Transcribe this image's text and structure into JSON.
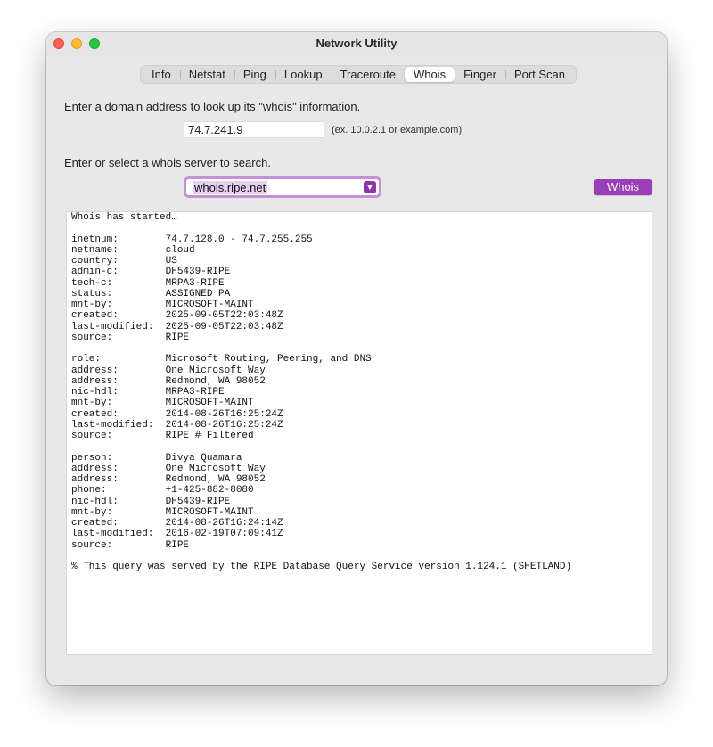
{
  "window": {
    "title": "Network Utility"
  },
  "tabs": [
    {
      "label": "Info",
      "selected": false
    },
    {
      "label": "Netstat",
      "selected": false
    },
    {
      "label": "Ping",
      "selected": false
    },
    {
      "label": "Lookup",
      "selected": false
    },
    {
      "label": "Traceroute",
      "selected": false
    },
    {
      "label": "Whois",
      "selected": true
    },
    {
      "label": "Finger",
      "selected": false
    },
    {
      "label": "Port Scan",
      "selected": false
    }
  ],
  "form": {
    "address_prompt": "Enter a domain address to look up its \"whois\" information.",
    "address_value": "74.7.241.9",
    "address_hint": "(ex. 10.0.2.1 or example.com)",
    "server_prompt": "Enter or select a whois server to search.",
    "server_value": "whois.ripe.net",
    "whois_button": "Whois"
  },
  "colors": {
    "accent": "#9b3fb8",
    "focus_ring": "#c193d6",
    "selection": "#e6cff0"
  },
  "output": {
    "lines": [
      "Whois has started…",
      "",
      "inetnum:        74.7.128.0 - 74.7.255.255",
      "netname:        cloud",
      "country:        US",
      "admin-c:        DH5439-RIPE",
      "tech-c:         MRPA3-RIPE",
      "status:         ASSIGNED PA",
      "mnt-by:         MICROSOFT-MAINT",
      "created:        2025-09-05T22:03:48Z",
      "last-modified:  2025-09-05T22:03:48Z",
      "source:         RIPE",
      "",
      "role:           Microsoft Routing, Peering, and DNS",
      "address:        One Microsoft Way",
      "address:        Redmond, WA 98052",
      "nic-hdl:        MRPA3-RIPE",
      "mnt-by:         MICROSOFT-MAINT",
      "created:        2014-08-26T16:25:24Z",
      "last-modified:  2014-08-26T16:25:24Z",
      "source:         RIPE # Filtered",
      "",
      "person:         Divya Quamara",
      "address:        One Microsoft Way",
      "address:        Redmond, WA 98052",
      "phone:          +1-425-882-8080",
      "nic-hdl:        DH5439-RIPE",
      "mnt-by:         MICROSOFT-MAINT",
      "created:        2014-08-26T16:24:14Z",
      "last-modified:  2016-02-19T07:09:41Z",
      "source:         RIPE",
      "",
      "% This query was served by the RIPE Database Query Service version 1.124.1 (SHETLAND)"
    ]
  }
}
